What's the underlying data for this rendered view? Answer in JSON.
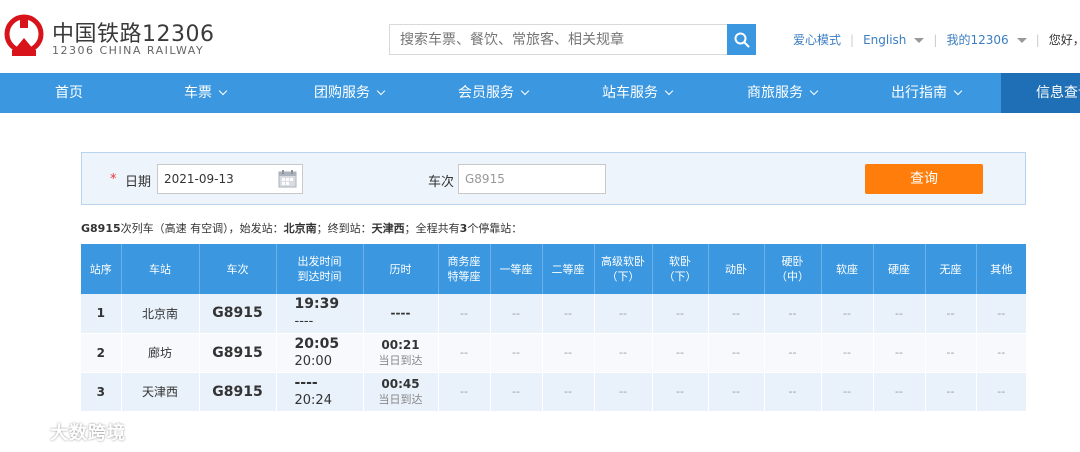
{
  "brand": {
    "name_cn": "中国铁路12306",
    "name_en": "12306 CHINA RAILWAY",
    "color": "#d8131a"
  },
  "search": {
    "placeholder": "搜索车票、餐饮、常旅客、相关规章",
    "icon": "search-icon"
  },
  "top_links": {
    "care_mode": "爱心模式",
    "english": "English",
    "my_12306": "我的12306",
    "greeting": "您好，请"
  },
  "nav": {
    "items": [
      {
        "label": "首页",
        "has_dropdown": false
      },
      {
        "label": "车票",
        "has_dropdown": true
      },
      {
        "label": "团购服务",
        "has_dropdown": true
      },
      {
        "label": "会员服务",
        "has_dropdown": true
      },
      {
        "label": "站车服务",
        "has_dropdown": true
      },
      {
        "label": "商旅服务",
        "has_dropdown": true
      },
      {
        "label": "出行指南",
        "has_dropdown": true
      },
      {
        "label": "信息查询",
        "has_dropdown": false,
        "active": true
      }
    ],
    "color": "#3a97e0",
    "active_color": "#1f6fb6"
  },
  "query": {
    "required_mark": "*",
    "date_label": "日期",
    "date_value": "2021-09-13",
    "train_label": "车次",
    "train_value": "G8915",
    "submit_label": "查询",
    "submit_color": "#ff7d0a"
  },
  "summary": {
    "train_no": "G8915",
    "train_desc": "次列车（高速 有空调），始发站：",
    "origin": "北京南",
    "dest_label": "；终到站：",
    "destination": "天津西",
    "stops_label": "；全程共有",
    "stops_count": "3",
    "stops_suffix": "个停靠站："
  },
  "table": {
    "headers": [
      "站序",
      "车站",
      "车次",
      "出发时间\n到达时间",
      "历时",
      "商务座\n特等座",
      "一等座",
      "二等座",
      "高级软卧\n（下）",
      "软卧\n（下）",
      "动卧",
      "硬卧\n（中）",
      "软座",
      "硬座",
      "无座",
      "其他"
    ],
    "rows": [
      {
        "seq": "1",
        "station": "北京南",
        "train": "G8915",
        "depart": "19:39",
        "arrive": "----",
        "duration": "----",
        "duration_note": "",
        "seats": [
          "--",
          "--",
          "--",
          "--",
          "--",
          "--",
          "--",
          "--",
          "--",
          "--",
          "--"
        ]
      },
      {
        "seq": "2",
        "station": "廊坊",
        "train": "G8915",
        "depart": "20:05",
        "arrive": "20:00",
        "duration": "00:21",
        "duration_note": "当日到达",
        "seats": [
          "--",
          "--",
          "--",
          "--",
          "--",
          "--",
          "--",
          "--",
          "--",
          "--",
          "--"
        ]
      },
      {
        "seq": "3",
        "station": "天津西",
        "train": "G8915",
        "depart": "----",
        "arrive": "20:24",
        "duration": "00:45",
        "duration_note": "当日到达",
        "seats": [
          "--",
          "--",
          "--",
          "--",
          "--",
          "--",
          "--",
          "--",
          "--",
          "--",
          "--"
        ]
      }
    ]
  },
  "watermark": {
    "text": "大数跨境",
    "icon": "watermark-logo-icon"
  }
}
